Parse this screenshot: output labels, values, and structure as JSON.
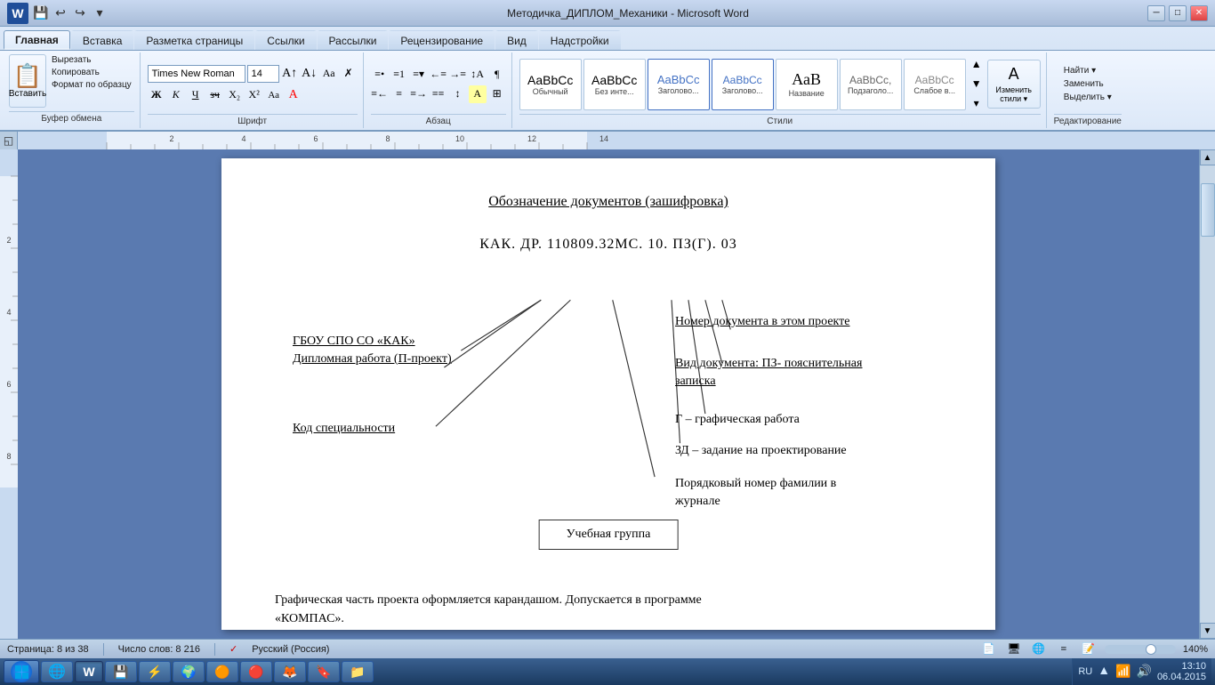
{
  "titlebar": {
    "title": "Методичка_ДИПЛОМ_Механики - Microsoft Word",
    "minimize": "─",
    "restore": "□",
    "close": "✕"
  },
  "ribbon": {
    "tabs": [
      "Главная",
      "Вставка",
      "Разметка страницы",
      "Ссылки",
      "Рассылки",
      "Рецензирование",
      "Вид",
      "Надстройки"
    ],
    "active_tab": "Главная",
    "font_name": "Times New Roman",
    "font_size": "14",
    "groups": {
      "clipboard": "Буфер обмена",
      "font": "Шрифт",
      "paragraph": "Абзац",
      "styles": "Стили",
      "editing": "Редактирование"
    },
    "clipboard_items": [
      "Вырезать",
      "Копировать",
      "Формат по образцу"
    ],
    "paste_label": "Вставить",
    "styles_list": [
      "Обычный",
      "Без инте...",
      "Заголово...",
      "Заголово...",
      "Название",
      "Подзаголо...",
      "Слабое в..."
    ],
    "edit_buttons": [
      "Найти ▾",
      "Заменить",
      "Выделить ▾"
    ],
    "change_styles": "Изменить стили ▾"
  },
  "document": {
    "title": "Обозначение документов (зашифровка)",
    "code_line": "КАК. ДР. 110809.32МС. 10. ПЗ(Г). 03",
    "label_org_line1": "ГБОУ СПО СО «КАК»",
    "label_org_line2": "Дипломная работа (П-проект)",
    "label_specialty": "Код специальности",
    "label_num_doc": "Номер документа в этом проекте",
    "label_doc_type_line1": "Вид документа: ПЗ- пояснительная",
    "label_doc_type_line2": "записка",
    "label_g": "Г – графическая работа",
    "label_3d": "ЗД – задание на проектирование",
    "label_order_line1": "Порядковый номер фамилии в",
    "label_order_line2": "журнале",
    "label_group": "Учебная группа",
    "footer_text_line1": "Графическая часть проекта оформляется карандашом. Допускается в программе",
    "footer_text_line2": "«КОМПАС»."
  },
  "statusbar": {
    "page": "Страница: 8 из 38",
    "words": "Число слов: 8 216",
    "lang": "Русский (Россия)",
    "zoom": "140%"
  },
  "taskbar": {
    "time": "13:10",
    "date": "06.04.2015",
    "lang": "RU"
  }
}
